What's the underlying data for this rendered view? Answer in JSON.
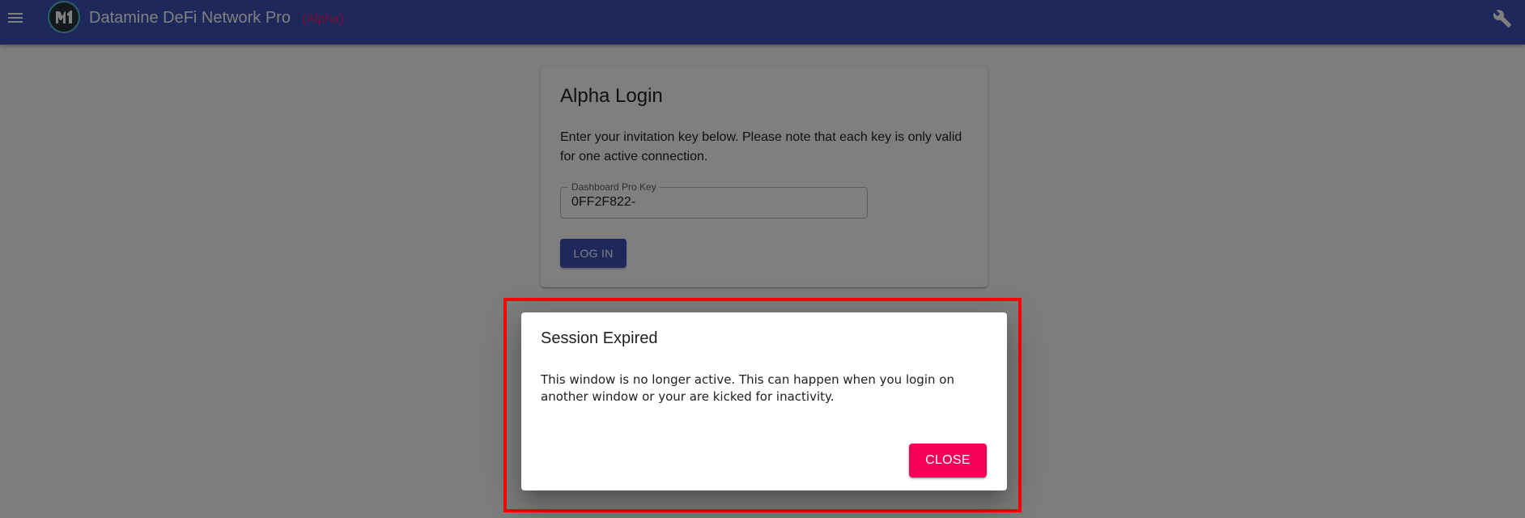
{
  "app_bar": {
    "title": "Datamine DeFi Network Pro",
    "badge": "(Alpha)",
    "menu_icon": "menu-icon",
    "logo_icon": "datamine-logo-icon",
    "settings_icon": "wrench-icon",
    "colors": {
      "background": "#3f51b5",
      "badge": "#ec1b6e"
    }
  },
  "login_card": {
    "title": "Alpha Login",
    "description": "Enter your invitation key below. Please note that each key is only valid for one active connection.",
    "key_field": {
      "label": "Dashboard Pro Key",
      "value": "0FF2F822-"
    },
    "login_button_label": "LOG IN"
  },
  "dialog": {
    "title": "Session Expired",
    "message": "This window is no longer active. This can happen when you login on another window or your are kicked for inactivity.",
    "close_button_label": "CLOSE",
    "colors": {
      "close_button": "#f50057",
      "highlight": "#ff0000"
    }
  }
}
